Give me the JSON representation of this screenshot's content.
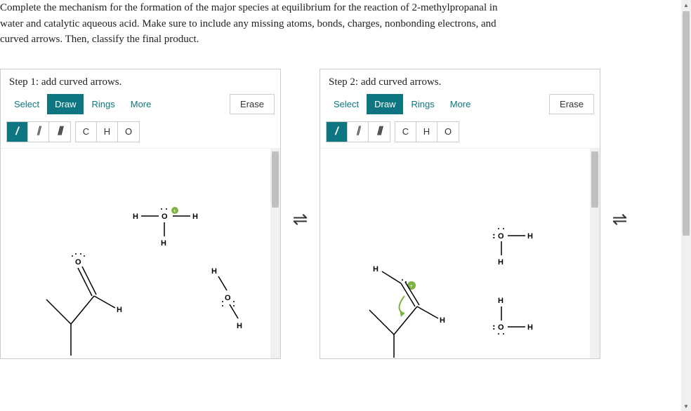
{
  "question": {
    "line1": "Complete the mechanism for the formation of the major species at equilibrium for the reaction of 2-methylpropanal in",
    "line2": "water and catalytic aqueous acid. Make sure to include any missing atoms, bonds, charges, nonbonding electrons, and",
    "line3": "curved arrows. Then, classify the final product."
  },
  "panels": [
    {
      "title": "Step 1: add curved arrows.",
      "tabs": {
        "select": "Select",
        "draw": "Draw",
        "rings": "Rings",
        "more": "More"
      },
      "erase": "Erase",
      "atoms": {
        "c": "C",
        "h": "H",
        "o": "O"
      }
    },
    {
      "title": "Step 2: add curved arrows.",
      "tabs": {
        "select": "Select",
        "draw": "Draw",
        "rings": "Rings",
        "more": "More"
      },
      "erase": "Erase",
      "atoms": {
        "c": "C",
        "h": "H",
        "o": "O"
      }
    }
  ],
  "equilibrium_symbol": "⇌"
}
